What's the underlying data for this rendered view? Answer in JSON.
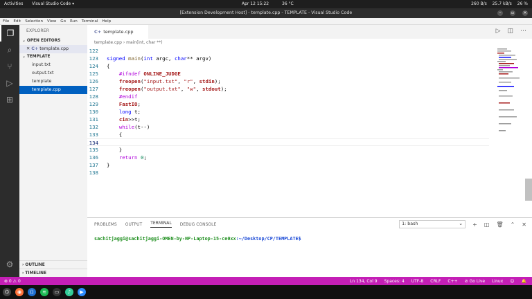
{
  "os": {
    "activities": "Activities",
    "app_name": "Visual Studio Code ▾",
    "clock": "Apr 12  15:22",
    "weather": "36 °C",
    "net_down": "260 B/s",
    "net_speed": "25.7 kB/s",
    "battery": "26 %"
  },
  "window": {
    "title": "[Extension Development Host] - template.cpp - TEMPLATE - Visual Studio Code"
  },
  "menu": [
    "File",
    "Edit",
    "Selection",
    "View",
    "Go",
    "Run",
    "Terminal",
    "Help"
  ],
  "sidebar": {
    "title": "EXPLORER",
    "open_editors": "OPEN EDITORS",
    "open_file": "template.cpp",
    "folder": "TEMPLATE",
    "files": [
      "input.txt",
      "output.txt",
      "template",
      "template.cpp"
    ],
    "outline": "OUTLINE",
    "timeline": "TIMELINE"
  },
  "editor": {
    "tab_label": "template.cpp",
    "breadcrumb_file": "template.cpp",
    "breadcrumb_symbol": "main(int, char **)"
  },
  "code": {
    "lines": [
      {
        "n": "122",
        "t": ""
      },
      {
        "n": "123",
        "t": "signed main(int argc, char** argv)"
      },
      {
        "n": "124",
        "t": "{"
      },
      {
        "n": "125",
        "t": "    #ifndef ONLINE_JUDGE"
      },
      {
        "n": "126",
        "t": "    freopen(\"input.txt\", \"r\", stdin);"
      },
      {
        "n": "127",
        "t": "    freopen(\"output.txt\", \"w\", stdout);"
      },
      {
        "n": "128",
        "t": "    #endif"
      },
      {
        "n": "129",
        "t": "    FastIO;"
      },
      {
        "n": "130",
        "t": "    long t;"
      },
      {
        "n": "131",
        "t": "    cin>>t;"
      },
      {
        "n": "132",
        "t": "    while(t--)"
      },
      {
        "n": "133",
        "t": "    {"
      },
      {
        "n": "134",
        "t": ""
      },
      {
        "n": "135",
        "t": "    }"
      },
      {
        "n": "136",
        "t": "    return 0;"
      },
      {
        "n": "137",
        "t": "}"
      },
      {
        "n": "138",
        "t": ""
      }
    ]
  },
  "panel": {
    "tabs": [
      "PROBLEMS",
      "OUTPUT",
      "TERMINAL",
      "DEBUG CONSOLE"
    ],
    "terminal_select": "1: bash",
    "prompt_user": "sachitjaggi@sachitjaggi-OMEN-by-HP-Laptop-15-ce0xx",
    "prompt_path": ":~/Desktop/CP/TEMPLATE$"
  },
  "status": {
    "problems": "⊗ 0  ⚠ 0",
    "position": "Ln 134, Col 9",
    "spaces": "Spaces: 4",
    "encoding": "UTF-8",
    "eol": "CRLF",
    "language": "C++",
    "golive": "⊘ Go Live",
    "os": "Linux"
  }
}
